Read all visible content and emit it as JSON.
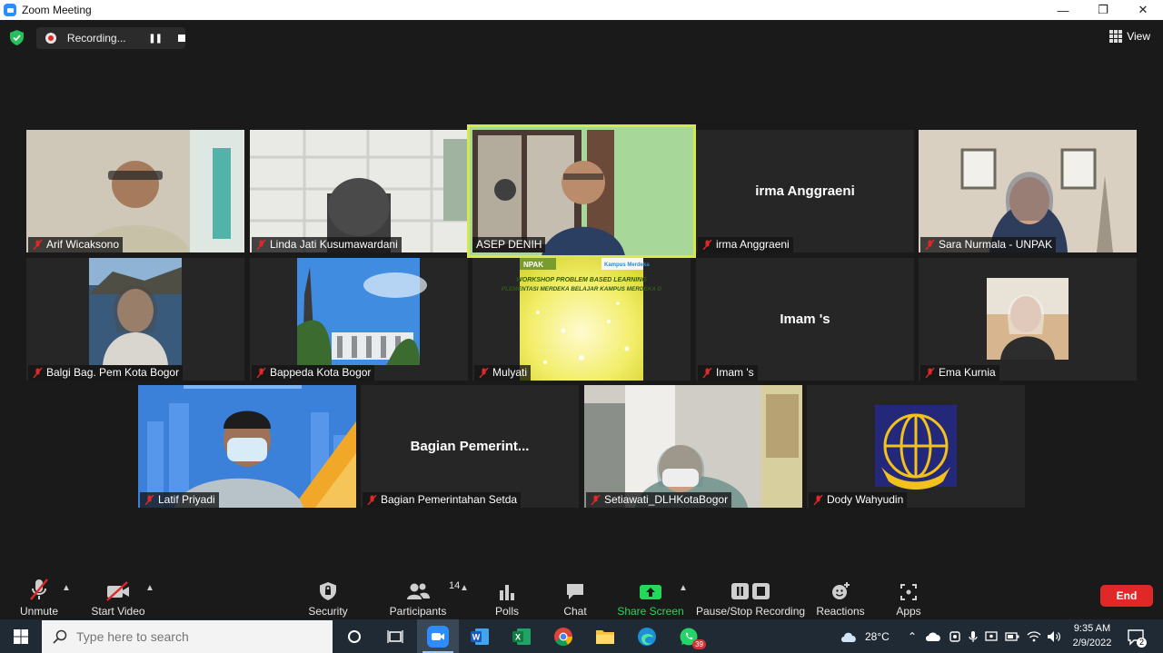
{
  "window": {
    "title": "Zoom Meeting",
    "controls": {
      "minimize": "—",
      "restore": "❐",
      "close": "✕"
    }
  },
  "topbar": {
    "recording_label": "Recording...",
    "view_label": "View"
  },
  "participants": [
    {
      "name": "Arif Wicaksono",
      "display": "video"
    },
    {
      "name": "Linda Jati Kusumawardani",
      "display": "video"
    },
    {
      "name": "ASEP DENIH",
      "display": "video",
      "active_speaker": true
    },
    {
      "name": "irma Anggraeni",
      "display": "name",
      "big_name": "irma Anggraeni"
    },
    {
      "name": "Sara Nurmala - UNPAK",
      "display": "video"
    },
    {
      "name": "Balgi Bag. Pem Kota Bogor",
      "display": "video"
    },
    {
      "name": "Bappeda Kota Bogor",
      "display": "video"
    },
    {
      "name": "Mulyati",
      "display": "video",
      "slide_lines": [
        "NPAK",
        "Kampus Merdeka",
        "WORKSHOP PROBLEM BASED LEARNING",
        "PLEMENTASI MERDEKA BELAJAR KAMPUS MERDEKA D"
      ]
    },
    {
      "name": "Imam 's",
      "display": "name",
      "big_name": "Imam 's"
    },
    {
      "name": "Ema Kurnia",
      "display": "video"
    },
    {
      "name": "Latif Priyadi",
      "display": "video"
    },
    {
      "name": "Bagian Pemerintahan Setda",
      "display": "name",
      "big_name": "Bagian  Pemerint..."
    },
    {
      "name": "Setiawati_DLHKotaBogor",
      "display": "video"
    },
    {
      "name": "Dody Wahyudin",
      "display": "video"
    }
  ],
  "toolbar": {
    "unmute": "Unmute",
    "start_video": "Start Video",
    "security": "Security",
    "participants": "Participants",
    "participants_count": "14",
    "polls": "Polls",
    "chat": "Chat",
    "share_screen": "Share Screen",
    "pause_stop_recording": "Pause/Stop Recording",
    "reactions": "Reactions",
    "apps": "Apps",
    "end": "End"
  },
  "taskbar": {
    "search_placeholder": "Type here to search",
    "whatsapp_badge": "39",
    "temperature": "28°C",
    "time": "9:35 AM",
    "date": "2/9/2022",
    "notifications_count": "2"
  },
  "colors": {
    "zoom_blue": "#2d8cff",
    "end_red": "#e02828",
    "share_green": "#23d959",
    "active_speaker": "#d6e84b",
    "background": "#1a1a1a",
    "taskbar": "#1f2a35"
  }
}
